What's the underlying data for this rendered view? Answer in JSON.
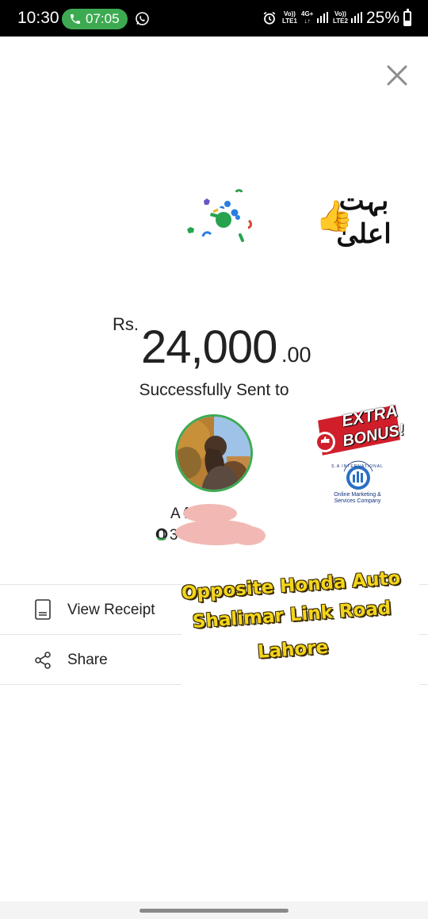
{
  "status_bar": {
    "time": "10:30",
    "call_duration": "07:05",
    "sim1_label_top": "Vo))",
    "sim1_label_bottom": "LTE1",
    "net_top": "4G+",
    "net_bottom": "↓↑",
    "sim2_label_top": "Vo))",
    "sim2_label_bottom": "LTE2",
    "battery_percent": "25%",
    "icons": [
      "phone-icon",
      "whatsapp-icon",
      "alarm-icon",
      "signal-icon",
      "battery-icon"
    ]
  },
  "close_icon": "close-icon",
  "sticker": {
    "urdu_text": "بہت اعلیٰ",
    "emoji": "👍"
  },
  "amount": {
    "currency": "Rs.",
    "value": "24,000",
    "decimals": ".00"
  },
  "status_message": "Successfully Sent to",
  "recipient": {
    "name_visible": "A        f lar",
    "number_visible": "0              3"
  },
  "extra_bonus": {
    "line1": "EXTRA",
    "line2": "BONUS!"
  },
  "sa_logo": {
    "arc_text": "S.A INTERNATIONAL",
    "line1": "Online Marketing &",
    "line2": "Services Company"
  },
  "actions": [
    {
      "label": "View Receipt",
      "icon": "receipt-icon"
    },
    {
      "label": "Share",
      "icon": "share-icon"
    }
  ],
  "overlay_text": {
    "line1": "Opposite Honda Auto",
    "line2": "Shalimar Link Road",
    "line3": "Lahore"
  },
  "colors": {
    "accent_green": "#3daa52",
    "overlay_yellow": "#f3d51b",
    "text_dark": "#222222"
  }
}
